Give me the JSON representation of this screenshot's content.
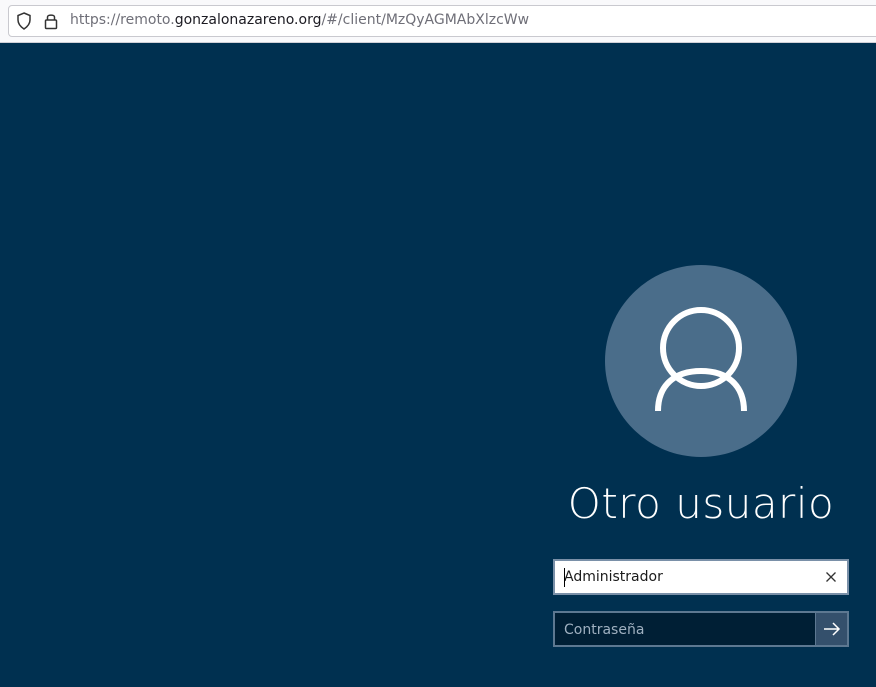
{
  "browser": {
    "url_prefix": "https://remoto.",
    "url_domain": "gonzalonazareno.org",
    "url_suffix": "/#/client/MzQyAGMAbXlzcWw"
  },
  "login": {
    "title": "Otro usuario",
    "username_value": "Administrador",
    "password_placeholder": "Contraseña"
  },
  "colors": {
    "background": "#003050",
    "avatar": "#4a6d8a",
    "password_field": "#001f35"
  },
  "icons": {
    "shield": "shield-icon",
    "lock": "lock-icon",
    "avatar": "user-icon",
    "clear": "close-icon",
    "submit": "arrow-right-icon"
  }
}
